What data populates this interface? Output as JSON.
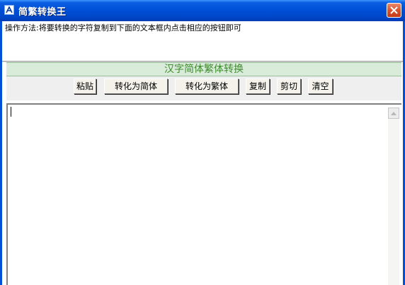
{
  "window": {
    "title": "简繁转换王",
    "icon": "app-icon",
    "close_icon": "close-icon"
  },
  "instructions": "操作方法:将要转换的字符复制到下面的文本框内点击相应的按钮即可",
  "header": {
    "title": "汉字简体繁体转换",
    "color": "#3e8a2e"
  },
  "toolbar": {
    "paste_label": "粘贴",
    "to_simplified_label": "转化为简体",
    "to_traditional_label": "转化为繁体",
    "copy_label": "复制",
    "cut_label": "剪切",
    "clear_label": "清空"
  },
  "editor": {
    "value": "",
    "scroll_up_icon": "scroll-up-arrow-icon"
  },
  "colors": {
    "titlebar": "#0050d8",
    "close_button": "#d9542e",
    "header_band": "#d9ecd9"
  }
}
